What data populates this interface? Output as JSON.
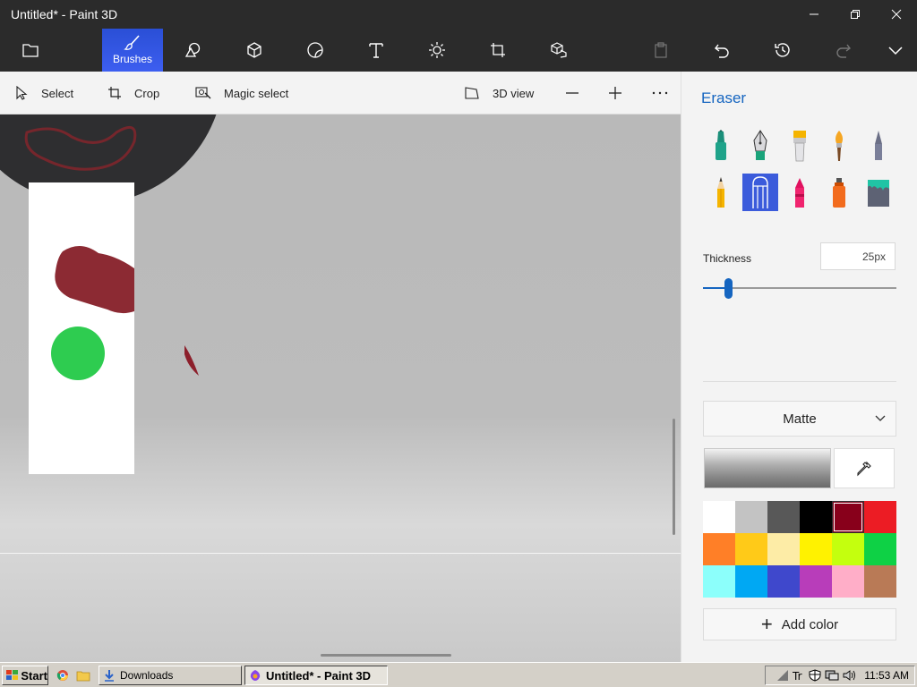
{
  "window": {
    "title": "Untitled* - Paint 3D"
  },
  "ribbon": {
    "active_label": "Brushes",
    "tools": [
      "menu",
      "brushes",
      "2d-shapes",
      "3d-shapes",
      "stickers",
      "text",
      "effects",
      "canvas",
      "3d-library"
    ]
  },
  "toolbar": {
    "select": "Select",
    "crop": "Crop",
    "magic_select": "Magic select",
    "view3d": "3D view"
  },
  "panel": {
    "title": "Eraser",
    "thickness_label": "Thickness",
    "thickness_value": "25px",
    "thickness_level": 0.13,
    "material": "Matte",
    "add_color": "Add color",
    "palette": [
      "#ffffff",
      "#c3c3c3",
      "#585858",
      "#000000",
      "#88001b",
      "#ec1c24",
      "#ff7f27",
      "#ffca18",
      "#fdeca6",
      "#fff200",
      "#c4ff0e",
      "#0ed145",
      "#8cfffb",
      "#00a8f3",
      "#3f48cc",
      "#b83dba",
      "#ffaec8",
      "#b97a56"
    ],
    "selected_color": "#88001b"
  },
  "taskbar": {
    "start": "Start",
    "downloads": "Downloads",
    "paint_window": "Untitled* - Paint 3D",
    "clock": "11:53 AM"
  }
}
